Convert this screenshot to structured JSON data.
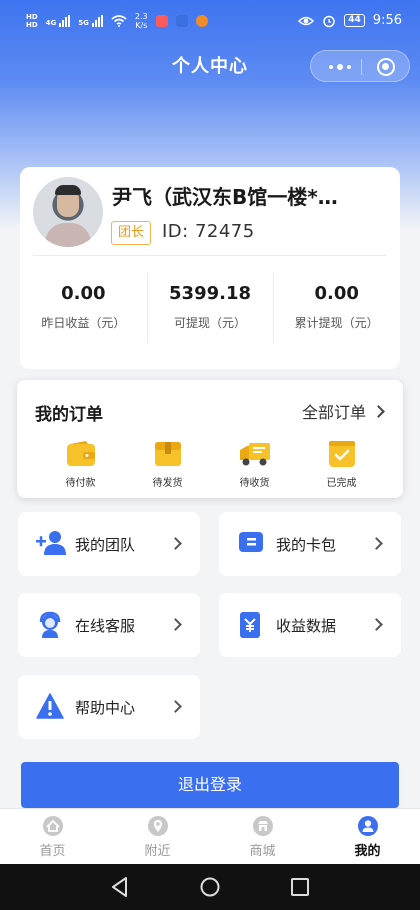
{
  "status_bar": {
    "network_tags": [
      "HD",
      "HD"
    ],
    "net_gen_1": "4G",
    "net_gen_2": "5G",
    "speed_value": "2.3",
    "speed_unit": "K/s",
    "battery": "44",
    "time": "9:56"
  },
  "header": {
    "title": "个人中心"
  },
  "profile": {
    "name": "尹飞（武汉东B馆一楼*…",
    "role_badge": "团长",
    "id_text": "ID:  72475",
    "stats": [
      {
        "value": "0.00",
        "label": "昨日收益（元）"
      },
      {
        "value": "5399.18",
        "label": "可提现（元）"
      },
      {
        "value": "0.00",
        "label": "累计提现（元）"
      }
    ]
  },
  "orders": {
    "title": "我的订单",
    "all_label": "全部订单",
    "items": [
      {
        "label": "待付款",
        "icon": "wallet-icon"
      },
      {
        "label": "待发货",
        "icon": "package-icon"
      },
      {
        "label": "待收货",
        "icon": "truck-icon"
      },
      {
        "label": "已完成",
        "icon": "done-icon"
      }
    ]
  },
  "menu": [
    {
      "label": "我的团队",
      "icon": "add-user-icon"
    },
    {
      "label": "我的卡包",
      "icon": "card-icon"
    },
    {
      "label": "在线客服",
      "icon": "support-icon"
    },
    {
      "label": "收益数据",
      "icon": "earnings-icon"
    },
    {
      "label": "帮助中心",
      "icon": "warning-icon"
    }
  ],
  "logout_label": "退出登录",
  "tabs": [
    {
      "label": "首页",
      "active": false
    },
    {
      "label": "附近",
      "active": false
    },
    {
      "label": "商城",
      "active": false
    },
    {
      "label": "我的",
      "active": true
    }
  ],
  "colors": {
    "primary": "#3a6ff0",
    "badge": "#e89a20",
    "order_icon": "#f7c12a"
  }
}
